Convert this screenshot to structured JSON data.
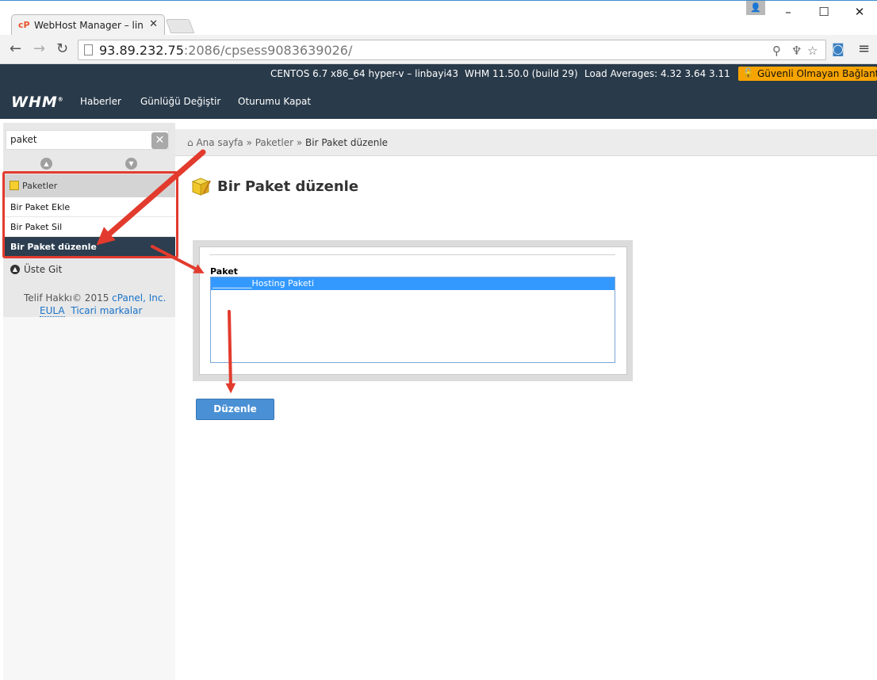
{
  "browser": {
    "tab_title": "WebHost Manager – linba",
    "tab_icon": "cP",
    "url_host": "93.89.232.75",
    "url_rest": ":2086/cpsess9083639026/"
  },
  "whm": {
    "os_info": "CENTOS 6.7 x86_64 hyper-v – linbayi43",
    "version": "WHM 11.50.0 (build 29)",
    "load": "Load Averages: 4.32 3.64 3.11",
    "insecure_label": "Güvenli Olmayan Bağlantı",
    "logo": "WHM",
    "nav": [
      "Haberler",
      "Günlüğü Değiştir",
      "Oturumu Kapat"
    ]
  },
  "sidebar": {
    "search_value": "paket",
    "group_label": "Paketler",
    "items": [
      "Bir Paket Ekle",
      "Bir Paket Sil",
      "Bir Paket düzenle"
    ],
    "active_index": 2,
    "scroll_top": "Üste Git",
    "copyright_prefix": "Telif Hakkı© 2015",
    "copyright_link": "cPanel, Inc.",
    "eula": "EULA",
    "trademarks": "Ticari markalar"
  },
  "main": {
    "breadcrumb_home": "Ana sayfa",
    "breadcrumb_sep": "»",
    "breadcrumb_mid": "Paketler",
    "breadcrumb_current": "Bir Paket düzenle",
    "title": "Bir Paket düzenle",
    "field_label": "Paket",
    "selected_option": "_________Hosting Paketi",
    "submit_label": "Düzenle"
  },
  "colors": {
    "header_bg": "#293a4a",
    "annotation_red": "#e23b2e",
    "button_blue": "#4a90d4",
    "insecure_bg": "#f7a400"
  }
}
